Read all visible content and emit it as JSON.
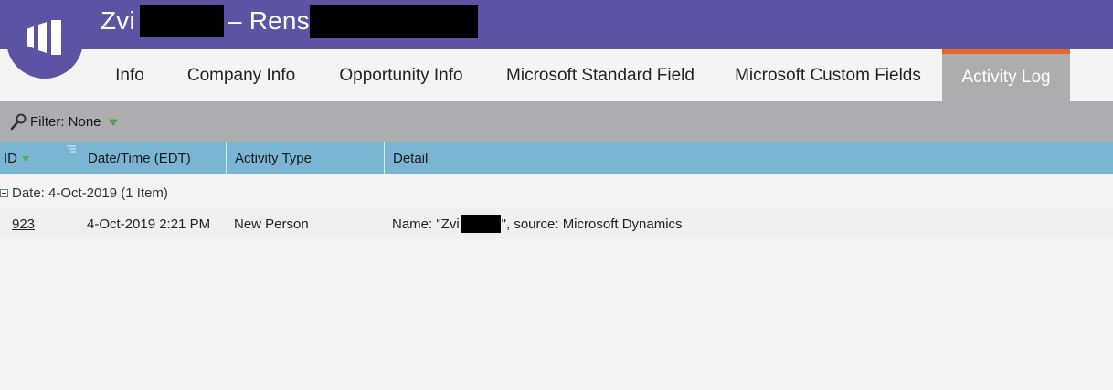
{
  "header": {
    "title_first": "Zvi",
    "title_sep": "– Rens",
    "bg_color": "#5c53a4"
  },
  "tabs": [
    {
      "label": "Info",
      "active": false
    },
    {
      "label": "Company Info",
      "active": false
    },
    {
      "label": "Opportunity Info",
      "active": false
    },
    {
      "label": "Microsoft Standard Field",
      "active": false
    },
    {
      "label": "Microsoft Custom Fields",
      "active": false
    },
    {
      "label": "Activity Log",
      "active": true
    }
  ],
  "filter": {
    "label": "Filter: None",
    "icon": "wrench-icon"
  },
  "grid": {
    "columns": [
      "ID",
      "Date/Time (EDT)",
      "Activity Type",
      "Detail"
    ],
    "group": {
      "label": "Date: 4-Oct-2019 (1 Item)"
    },
    "rows": [
      {
        "id": "923",
        "datetime": "4-Oct-2019 2:21 PM",
        "activity_type": "New Person",
        "detail_prefix": "Name: \"Zvi",
        "detail_suffix": "\", source: Microsoft Dynamics"
      }
    ]
  },
  "colors": {
    "accent_orange": "#e2682a",
    "grid_header": "#7ab5d3",
    "filter_bar": "#adadb0",
    "sort_green": "#4caf50"
  }
}
